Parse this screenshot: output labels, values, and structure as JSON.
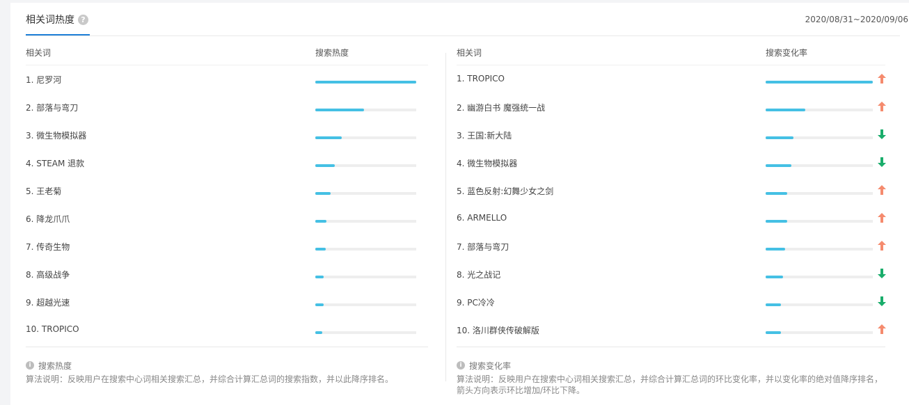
{
  "header": {
    "tab_label": "相关词热度",
    "help_glyph": "?",
    "date_range": "2020/08/31~2020/09/06"
  },
  "left": {
    "col_keyword": "相关词",
    "col_metric": "搜索热度",
    "rows": [
      {
        "label": "1.   尼罗河",
        "heat": 1.0
      },
      {
        "label": "2.   部落与弯刀",
        "heat": 0.48
      },
      {
        "label": "3.   微生物模拟器",
        "heat": 0.26
      },
      {
        "label": "4.   STEAM 退款",
        "heat": 0.19
      },
      {
        "label": "5.   王老菊",
        "heat": 0.15
      },
      {
        "label": "6.   降龙爪爪",
        "heat": 0.11
      },
      {
        "label": "7.   传奇生物",
        "heat": 0.1
      },
      {
        "label": "8.   高级战争",
        "heat": 0.08
      },
      {
        "label": "9.   超越光速",
        "heat": 0.08
      },
      {
        "label": "10. TROPICO",
        "heat": 0.07
      }
    ],
    "note_title": "搜索热度",
    "note_desc": "算法说明：反映用户在搜索中心词相关搜索汇总，并综合计算汇总词的搜索指数，并以此降序排名。"
  },
  "right": {
    "col_keyword": "相关词",
    "col_metric": "搜索变化率",
    "rows": [
      {
        "label": "1.   TROPICO",
        "rate": 1.0,
        "dir": "up"
      },
      {
        "label": "2.   幽游白书 魔强统一战",
        "rate": 0.37,
        "dir": "up"
      },
      {
        "label": "3.   王国:新大陆",
        "rate": 0.26,
        "dir": "down"
      },
      {
        "label": "4.   微生物模拟器",
        "rate": 0.24,
        "dir": "down"
      },
      {
        "label": "5.   蓝色反射:幻舞少女之剑",
        "rate": 0.2,
        "dir": "up"
      },
      {
        "label": "6.   ARMELLO",
        "rate": 0.2,
        "dir": "up"
      },
      {
        "label": "7.   部落与弯刀",
        "rate": 0.18,
        "dir": "up"
      },
      {
        "label": "8.   光之战记",
        "rate": 0.16,
        "dir": "down"
      },
      {
        "label": "9.   PC冷冷",
        "rate": 0.14,
        "dir": "down"
      },
      {
        "label": "10. 洛川群侠传破解版",
        "rate": 0.14,
        "dir": "up"
      }
    ],
    "note_title": "搜索变化率",
    "note_desc_1": "算法说明：反映用户在搜索中心词相关搜索汇总，并综合计算汇总词的环比变化率，并以变化率的绝对值降序排名，",
    "note_desc_2": "箭头方向表示环比增加/环比下降。"
  },
  "colors": {
    "bar": "#45c0e4",
    "track": "#eeeeee",
    "up": "#f58b6e",
    "down": "#1aad6b",
    "tab_underline": "#1e7fd8"
  },
  "icons": {
    "help": "question-circle-icon",
    "info": "info-circle-icon",
    "up": "arrow-up-icon",
    "down": "arrow-down-icon"
  }
}
